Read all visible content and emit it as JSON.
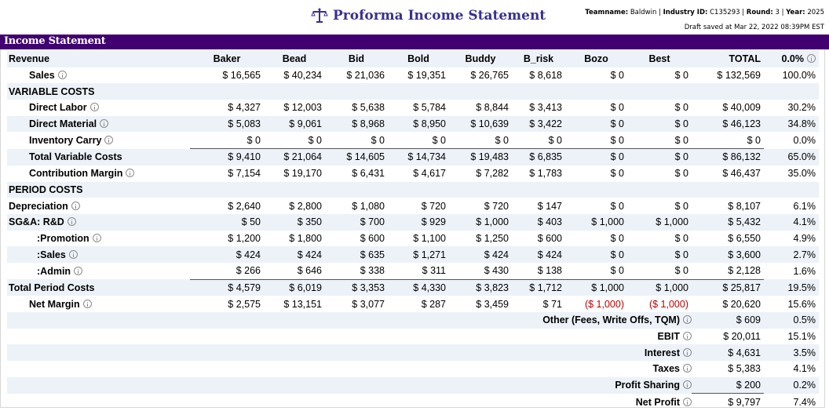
{
  "header": {
    "title": "Proforma Income Statement",
    "title_icon": "scales-icon",
    "teamname_label": "Teamname:",
    "teamname": "Baldwin",
    "industry_label": "Industry ID:",
    "industry": "C135293",
    "round_label": "Round:",
    "round": "3",
    "year_label": "Year:",
    "year": "2025",
    "draft_saved": "Draft saved at Mar 22, 2022 08:39PM EST"
  },
  "section_title": "Income Statement",
  "columns": [
    "Baker",
    "Bead",
    "Bid",
    "Bold",
    "Buddy",
    "B_risk",
    "Bozo",
    "Best",
    "TOTAL",
    "0.0%"
  ],
  "rows": [
    {
      "label": "Sales",
      "info": true,
      "values": [
        "$ 16,565",
        "$ 40,234",
        "$ 21,036",
        "$ 19,351",
        "$ 26,765",
        "$ 8,618",
        "$ 0",
        "$ 0",
        "$ 132,569",
        "100.0%"
      ]
    },
    {
      "label": "VARIABLE COSTS"
    },
    {
      "label": "Direct Labor",
      "info": true,
      "values": [
        "$ 4,327",
        "$ 12,003",
        "$ 5,638",
        "$ 5,784",
        "$ 8,844",
        "$ 3,413",
        "$ 0",
        "$ 0",
        "$ 40,009",
        "30.2%"
      ]
    },
    {
      "label": "Direct Material",
      "info": true,
      "values": [
        "$ 5,083",
        "$ 9,061",
        "$ 8,968",
        "$ 8,950",
        "$ 10,639",
        "$ 3,422",
        "$ 0",
        "$ 0",
        "$ 46,123",
        "34.8%"
      ]
    },
    {
      "label": "Inventory Carry",
      "info": true,
      "values": [
        "$ 0",
        "$ 0",
        "$ 0",
        "$ 0",
        "$ 0",
        "$ 0",
        "$ 0",
        "$ 0",
        "$ 0",
        "0.0%"
      ]
    },
    {
      "label": "Total Variable Costs",
      "values": [
        "$ 9,410",
        "$ 21,064",
        "$ 14,605",
        "$ 14,734",
        "$ 19,483",
        "$ 6,835",
        "$ 0",
        "$ 0",
        "$ 86,132",
        "65.0%"
      ]
    },
    {
      "label": "Contribution Margin",
      "info": true,
      "values": [
        "$ 7,154",
        "$ 19,170",
        "$ 6,431",
        "$ 4,617",
        "$ 7,282",
        "$ 1,783",
        "$ 0",
        "$ 0",
        "$ 46,437",
        "35.0%"
      ]
    },
    {
      "label": "PERIOD COSTS"
    },
    {
      "label": "Depreciation",
      "info": true,
      "values": [
        "$ 2,640",
        "$ 2,800",
        "$ 1,080",
        "$ 720",
        "$ 720",
        "$ 147",
        "$ 0",
        "$ 0",
        "$ 8,107",
        "6.1%"
      ]
    },
    {
      "label": "SG&A: R&D",
      "info": true,
      "values": [
        "$ 50",
        "$ 350",
        "$ 700",
        "$ 929",
        "$ 1,000",
        "$ 403",
        "$ 1,000",
        "$ 1,000",
        "$ 5,432",
        "4.1%"
      ]
    },
    {
      "label": ":Promotion",
      "info": true,
      "values": [
        "$ 1,200",
        "$ 1,800",
        "$ 600",
        "$ 1,100",
        "$ 1,250",
        "$ 600",
        "$ 0",
        "$ 0",
        "$ 6,550",
        "4.9%"
      ]
    },
    {
      "label": ":Sales",
      "info": true,
      "values": [
        "$ 424",
        "$ 424",
        "$ 635",
        "$ 1,271",
        "$ 424",
        "$ 424",
        "$ 0",
        "$ 0",
        "$ 3,600",
        "2.7%"
      ]
    },
    {
      "label": ":Admin",
      "info": true,
      "values": [
        "$ 266",
        "$ 646",
        "$ 338",
        "$ 311",
        "$ 430",
        "$ 138",
        "$ 0",
        "$ 0",
        "$ 2,128",
        "1.6%"
      ]
    },
    {
      "label": "Total Period Costs",
      "values": [
        "$ 4,579",
        "$ 6,019",
        "$ 3,353",
        "$ 4,330",
        "$ 3,823",
        "$ 1,712",
        "$ 1,000",
        "$ 1,000",
        "$ 25,817",
        "19.5%"
      ]
    },
    {
      "label": "Net Margin",
      "info": true,
      "values": [
        "$ 2,575",
        "$ 13,151",
        "$ 3,077",
        "$ 287",
        "$ 3,459",
        "$ 71",
        "($ 1,000)",
        "($ 1,000)",
        "$ 20,620",
        "15.6%"
      ]
    }
  ],
  "summary": [
    {
      "label": "Other (Fees, Write Offs, TQM)",
      "value": "$ 609",
      "pct": "0.5%"
    },
    {
      "label": "EBIT",
      "value": "$ 20,011",
      "pct": "15.1%"
    },
    {
      "label": "Interest",
      "value": "$ 4,631",
      "pct": "3.5%"
    },
    {
      "label": "Taxes",
      "value": "$ 5,383",
      "pct": "4.1%"
    },
    {
      "label": "Profit Sharing",
      "value": "$ 200",
      "pct": "0.2%"
    },
    {
      "label": "Net Profit",
      "value": "$ 9,797",
      "pct": "7.4%"
    }
  ],
  "first_header": "Revenue",
  "colors": {
    "bar": "#400070",
    "title": "#3a3090",
    "negative": "#c00000",
    "row_shade": "#ecf2f8"
  }
}
